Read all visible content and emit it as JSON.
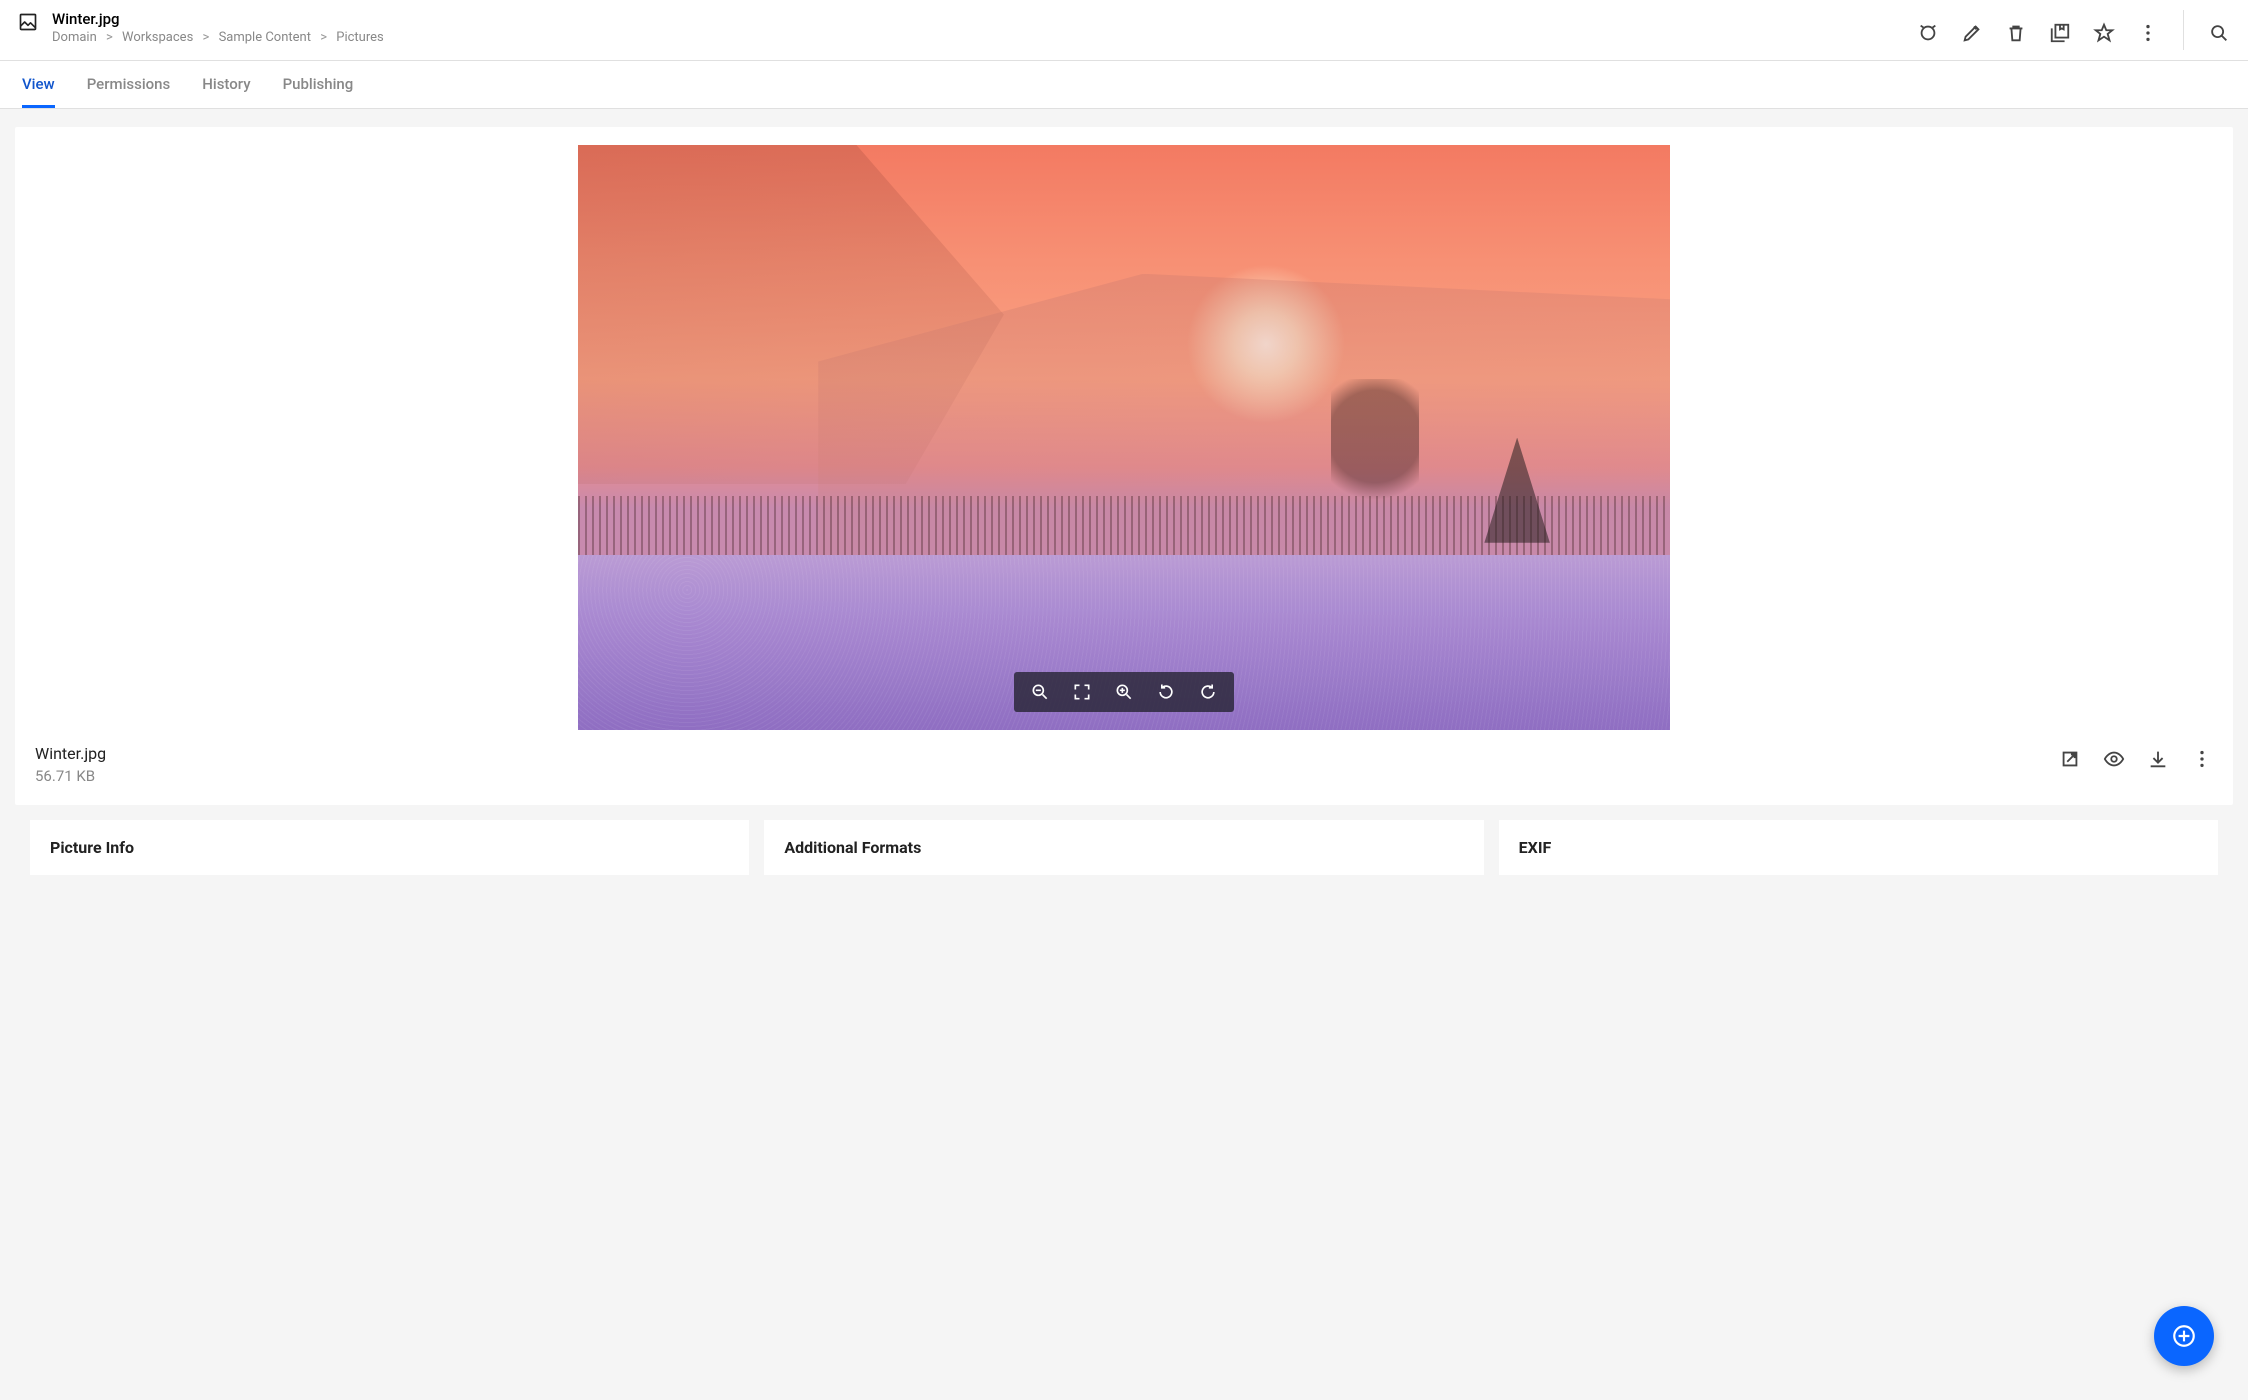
{
  "header": {
    "title": "Winter.jpg",
    "breadcrumb": [
      "Domain",
      "Workspaces",
      "Sample Content",
      "Pictures"
    ]
  },
  "tabs": [
    {
      "label": "View",
      "active": true
    },
    {
      "label": "Permissions",
      "active": false
    },
    {
      "label": "History",
      "active": false
    },
    {
      "label": "Publishing",
      "active": false
    }
  ],
  "preview": {
    "file_name": "Winter.jpg",
    "file_size": "56.71 KB"
  },
  "panels": [
    {
      "title": "Picture Info"
    },
    {
      "title": "Additional Formats"
    },
    {
      "title": "EXIF"
    }
  ]
}
